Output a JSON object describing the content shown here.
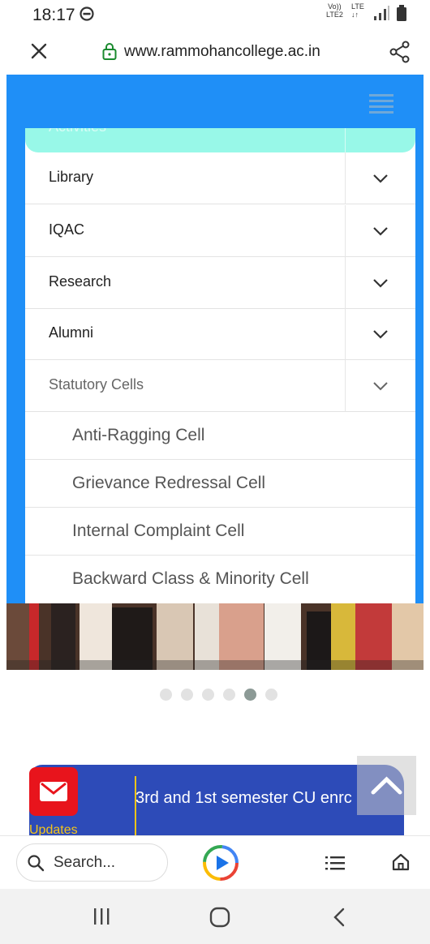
{
  "status_bar": {
    "time": "18:17",
    "network_top": "Vo))",
    "network_bottom": "LTE2",
    "network_type_top": "LTE",
    "network_type_bottom": "↓↑"
  },
  "browser": {
    "url": "www.rammohancollege.ac.in",
    "search_placeholder": "Search..."
  },
  "menu": {
    "partial_item": "Activities",
    "items": [
      {
        "label": "Library"
      },
      {
        "label": "IQAC"
      },
      {
        "label": "Research"
      },
      {
        "label": "Alumni"
      },
      {
        "label": "Statutory Cells"
      }
    ],
    "submenu": [
      {
        "label": "Anti-Ragging Cell"
      },
      {
        "label": "Grievance Redressal Cell"
      },
      {
        "label": "Internal Complaint Cell"
      },
      {
        "label": "Backward Class & Minority Cell"
      }
    ]
  },
  "carousel": {
    "dot_count": 6,
    "active_index": 4
  },
  "updates": {
    "label": "Updates",
    "ticker": "3rd and 1st semester CU enrc"
  },
  "colors": {
    "site_blue": "#1f8ff7",
    "active_menu": "#98f8e8",
    "updates_bg": "#2d4bb8",
    "updates_accent": "#f5c518",
    "mail_red": "#e8141c"
  }
}
